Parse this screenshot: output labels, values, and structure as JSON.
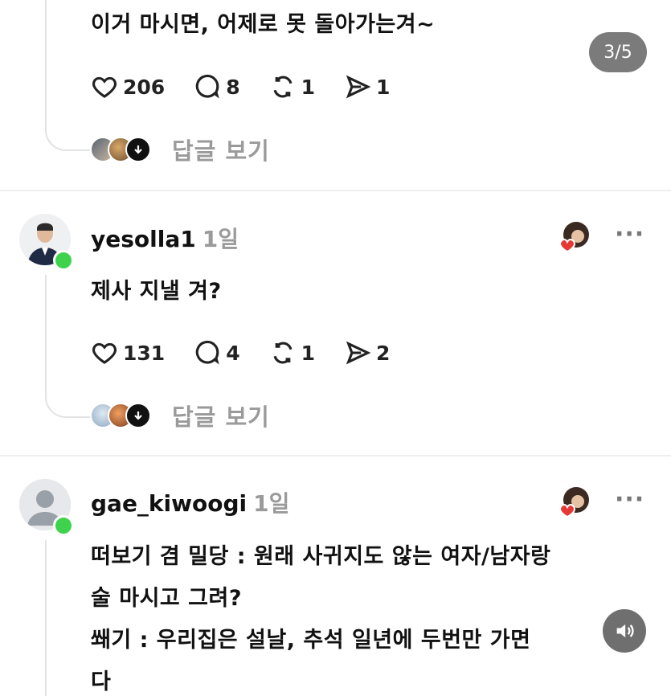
{
  "image_counter": "3/5",
  "post_top": {
    "text": "이거 마시면, 어제로 못 돌아가는겨~",
    "likes": "206",
    "comments": "8",
    "reposts": "1",
    "shares": "1",
    "replies_label": "답글 보기"
  },
  "post_2": {
    "username": "yesolla1",
    "time": "1일",
    "text": "제사 지낼 겨?",
    "likes": "131",
    "comments": "4",
    "reposts": "1",
    "shares": "2",
    "replies_label": "답글 보기"
  },
  "post_3": {
    "username": "gae_kiwoogi",
    "time": "1일",
    "lines": [
      "떠보기 겸 밀당 : 원래 사귀지도 않는 여자/남자랑",
      "술 마시고 그려?",
      "쐐기 : 우리집은 설날, 추석 일년에 두번만 가면",
      "다"
    ]
  },
  "more_label": "···",
  "icons": {
    "like": "heart-icon",
    "comment": "comment-icon",
    "repost": "repost-icon",
    "share": "send-icon",
    "sound": "speaker-icon"
  },
  "colors": {
    "online": "#3fd34d",
    "heart": "#e53935",
    "muted_text": "#9a9a9a",
    "badge_bg": "#7b7b7b"
  }
}
